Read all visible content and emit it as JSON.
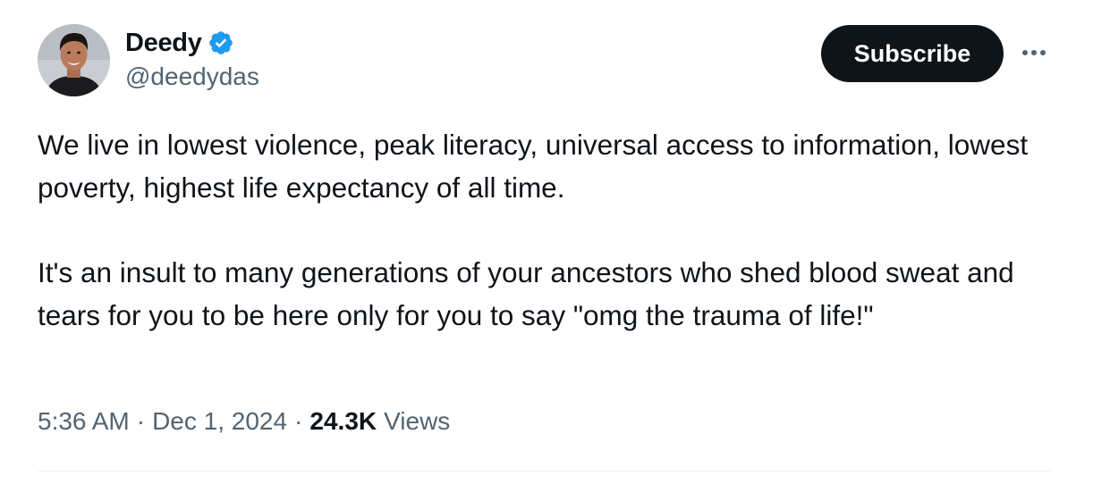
{
  "author": {
    "display_name": "Deedy",
    "handle": "@deedydas",
    "verified": true
  },
  "actions": {
    "subscribe_label": "Subscribe",
    "more_icon": "more-horizontal-icon"
  },
  "tweet": {
    "paragraphs": [
      "We live in lowest violence, peak literacy, universal access to information, lowest poverty, highest life expectancy of all time.",
      "It's an insult to many generations of your ancestors who shed blood sweat and tears for you to be here only for you to say \"omg the trauma of life!\""
    ]
  },
  "meta": {
    "time": "5:36 AM",
    "separator": "·",
    "date": "Dec 1, 2024",
    "views_count": "24.3K",
    "views_label": "Views"
  },
  "colors": {
    "text_primary": "#0f1419",
    "text_secondary": "#536471",
    "verified_blue": "#1d9bf0",
    "button_bg": "#0f1419"
  }
}
